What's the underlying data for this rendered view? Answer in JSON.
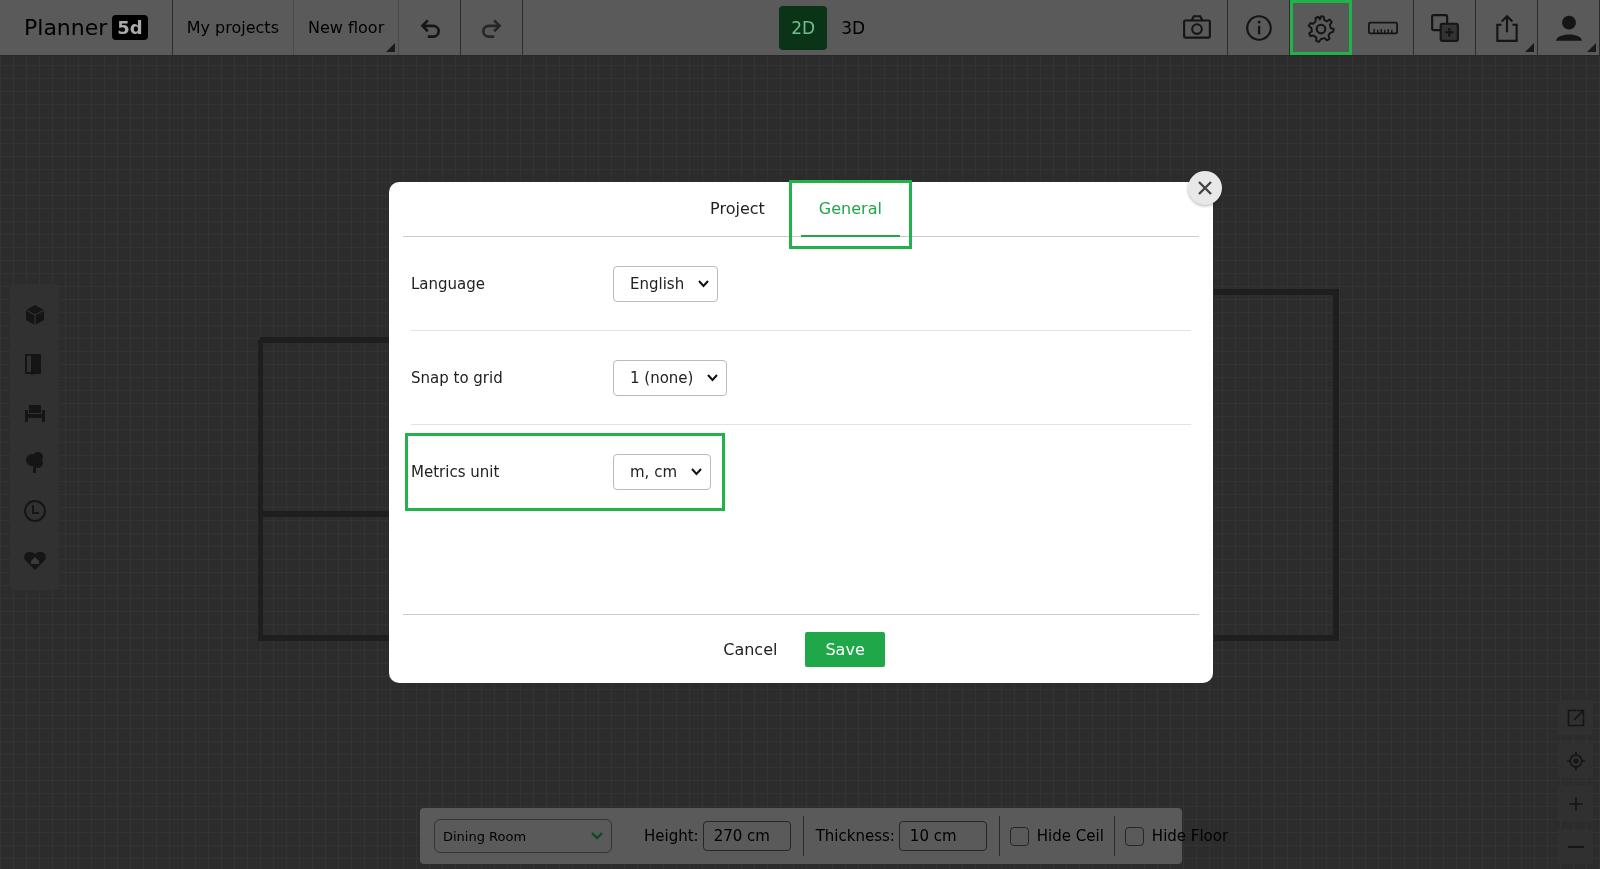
{
  "topbar": {
    "logo": {
      "text": "Planner",
      "badge": "5d"
    },
    "nav": [
      {
        "label": "My projects",
        "has_menu": false
      },
      {
        "label": "New floor",
        "has_menu": true
      }
    ],
    "history": [
      {
        "kind": "undo",
        "disabled": false
      },
      {
        "kind": "redo",
        "disabled": true
      }
    ],
    "view_modes": [
      {
        "label": "2D",
        "selected": true
      },
      {
        "label": "3D",
        "selected": false
      }
    ],
    "tools": [
      {
        "kind": "camera",
        "highlighted": false,
        "has_menu": false
      },
      {
        "kind": "info",
        "highlighted": false,
        "has_menu": false
      },
      {
        "kind": "settings",
        "highlighted": true,
        "has_menu": false
      },
      {
        "kind": "ruler",
        "highlighted": false,
        "has_menu": false
      },
      {
        "kind": "add-copy",
        "highlighted": false,
        "has_menu": false
      },
      {
        "kind": "share",
        "highlighted": false,
        "has_menu": true
      },
      {
        "kind": "user",
        "highlighted": false,
        "has_menu": true
      }
    ]
  },
  "sidebar": {
    "items": [
      {
        "kind": "cube"
      },
      {
        "kind": "door"
      },
      {
        "kind": "sofa"
      },
      {
        "kind": "tree"
      },
      {
        "kind": "clock"
      },
      {
        "kind": "heart-home"
      }
    ]
  },
  "view_controls": [
    {
      "kind": "external"
    },
    {
      "kind": "locate"
    },
    {
      "kind": "zoom-in"
    },
    {
      "kind": "zoom-out"
    }
  ],
  "dialog": {
    "tabs": [
      {
        "label": "Project",
        "selected": false,
        "highlighted": false
      },
      {
        "label": "General",
        "selected": true,
        "highlighted": true
      }
    ],
    "settings": [
      {
        "label": "Language",
        "value": "English",
        "highlighted": false
      },
      {
        "label": "Snap to grid",
        "value": "1 (none)",
        "highlighted": false
      },
      {
        "label": "Metrics unit",
        "value": "m, cm",
        "highlighted": true
      }
    ],
    "buttons": [
      {
        "label": "Cancel",
        "kind": "secondary"
      },
      {
        "label": "Save",
        "kind": "primary"
      }
    ]
  },
  "bottom_bar": {
    "room": "Dining Room",
    "height_label": "Height:",
    "height": "270 cm",
    "thickness_label": "Thickness:",
    "thickness": "10 cm",
    "toggles": [
      {
        "label": "Hide Ceil",
        "checked": false
      },
      {
        "label": "Hide Floor",
        "checked": false
      }
    ]
  }
}
